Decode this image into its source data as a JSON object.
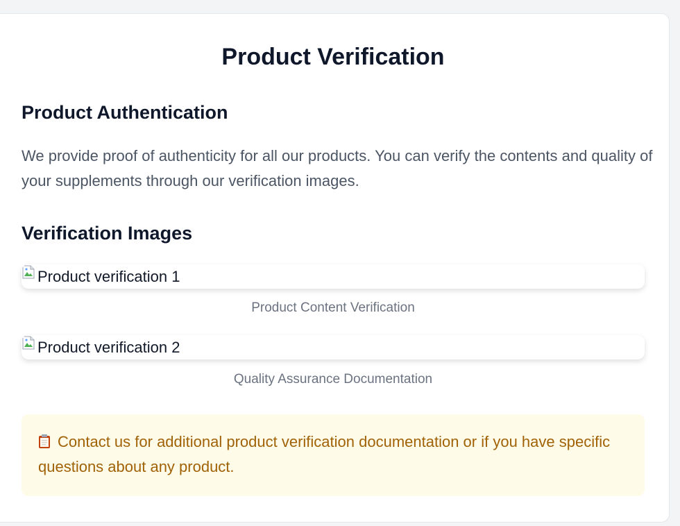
{
  "page": {
    "title": "Product Verification"
  },
  "authentication": {
    "heading": "Product Authentication",
    "text": "We provide proof of authenticity for all our products. You can verify the contents and quality of your supplements through our verification images."
  },
  "verification_images": {
    "heading": "Verification Images",
    "items": [
      {
        "alt": "Product verification 1",
        "caption": "Product Content Verification"
      },
      {
        "alt": "Product verification 2",
        "caption": "Quality Assurance Documentation"
      }
    ]
  },
  "notice": {
    "icon": "clipboard-icon",
    "text": "Contact us for additional product verification documentation or if you have specific questions about any product."
  },
  "colors": {
    "title": "#0f172a",
    "body_text": "#4b5563",
    "caption": "#6b7280",
    "notice_bg": "#fefce8",
    "notice_text": "#a16207"
  }
}
